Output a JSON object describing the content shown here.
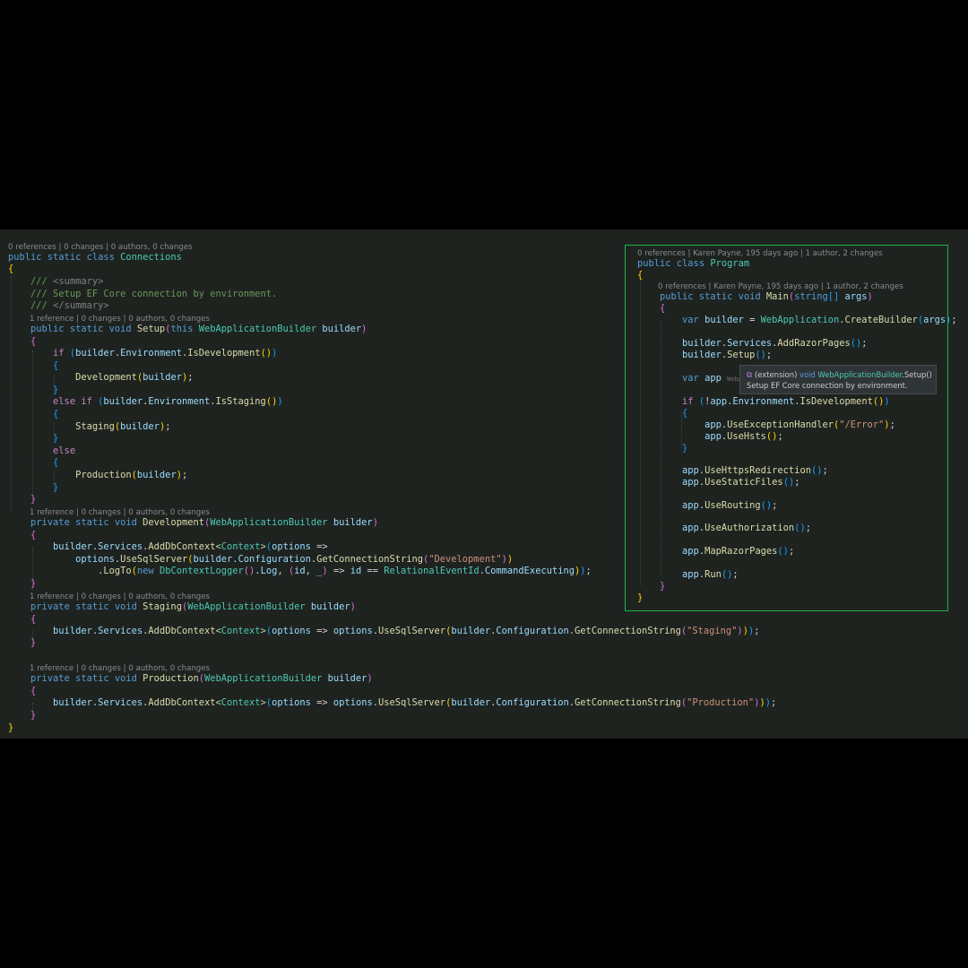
{
  "left_file": {
    "code_lens": [
      "0 references | 0 changes | 0 authors, 0 changes",
      "1 reference | 0 changes | 0 authors, 0 changes",
      "1 reference | 0 changes | 0 authors, 0 changes",
      "1 reference | 0 changes | 0 authors, 0 changes",
      "1 reference | 0 changes | 0 authors, 0 changes"
    ]
  },
  "right_file": {
    "code_lens": [
      "0 references | Karen Payne, 195 days ago | 1 author, 2 changes",
      "0 references | Karen Payne, 195 days ago | 1 author, 2 changes"
    ]
  },
  "tooltip": {
    "signature_prefix": "(extension) ",
    "signature_keyword": "void ",
    "signature_type": "WebApplicationBuilder",
    "signature_method": ".Setup()",
    "description": "Setup EF Core connection by environment."
  },
  "colors": {
    "editor_background": "#1e2320",
    "page_background": "#000000",
    "panel_border": "#21b04d",
    "keyword": "#569cd6",
    "type": "#4ec9b0",
    "method": "#dcdcaa",
    "variable": "#9cdcfe",
    "string": "#ce9178",
    "comment": "#6a9955"
  },
  "icons": {
    "tooltip": "extension-method-icon"
  }
}
